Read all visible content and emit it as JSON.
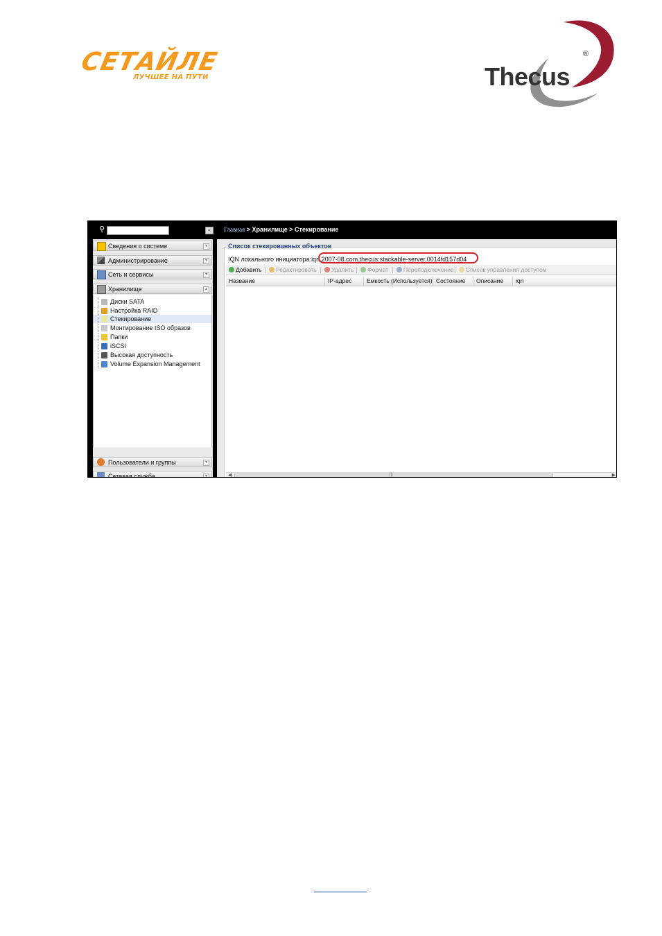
{
  "logos": {
    "left_wordmark": "СЕТАЙЛЕ",
    "left_slogan": "ЛУЧШЕЕ НА ПУТИ",
    "right_brand": "Thecus",
    "right_reg": "®"
  },
  "colors": {
    "orange": "#f39a1e",
    "thecus_red": "#9b1b30",
    "highlight_red": "#d0202a",
    "nav_black": "#000000"
  },
  "search": {
    "icon": "search-icon",
    "placeholder": ""
  },
  "breadcrumb": {
    "home": "Главная",
    "rest": " > Хранилище > Стекирование"
  },
  "sidebar": {
    "sections": [
      {
        "label": "Сведения о системе",
        "icon": "info-icon"
      },
      {
        "label": "Администрирование",
        "icon": "tools-icon"
      },
      {
        "label": "Сеть и сервисы",
        "icon": "network-icon"
      },
      {
        "label": "Хранилище",
        "icon": "storage-icon"
      },
      {
        "label": "Пользователи и группы",
        "icon": "users-icon"
      },
      {
        "label": "Сетевая служба",
        "icon": "network-service-icon"
      }
    ],
    "storage_items": [
      {
        "label": "Диски SATA",
        "icon": "disk-icon"
      },
      {
        "label": "Настройка RAID",
        "icon": "raid-icon"
      },
      {
        "label": "Стекирование",
        "icon": "stack-icon",
        "active": true
      },
      {
        "label": "Монтирование ISO образов",
        "icon": "iso-icon"
      },
      {
        "label": "Папки",
        "icon": "folder-icon"
      },
      {
        "label": "iSCSI",
        "icon": "iscsi-icon"
      },
      {
        "label": "Высокая доступность",
        "icon": "ha-icon"
      },
      {
        "label": "Volume Expansion Management",
        "icon": "volume-expansion-icon"
      }
    ]
  },
  "main": {
    "legend": "Список стекированных объектов",
    "iqn_label": "IQN локального инициатора:",
    "iqn_value": "iqn.2007-08.com.thecus:stackable-server.0014fd157d04",
    "toolbar": [
      {
        "label": "Добавить",
        "enabled": true,
        "icon": "add-icon"
      },
      {
        "label": "Редактировать",
        "enabled": false,
        "icon": "edit-icon"
      },
      {
        "label": "Удалить",
        "enabled": false,
        "icon": "delete-icon"
      },
      {
        "label": "Формат",
        "enabled": false,
        "icon": "format-icon"
      },
      {
        "label": "Переподключение",
        "enabled": false,
        "icon": "reconnect-icon"
      },
      {
        "label": "Список управления доступом",
        "enabled": false,
        "icon": "acl-icon"
      }
    ],
    "columns": [
      "Название",
      "IP-адрес",
      "Емкость (Используется)",
      "Состояние",
      "Описание",
      "iqn"
    ],
    "rows": []
  }
}
